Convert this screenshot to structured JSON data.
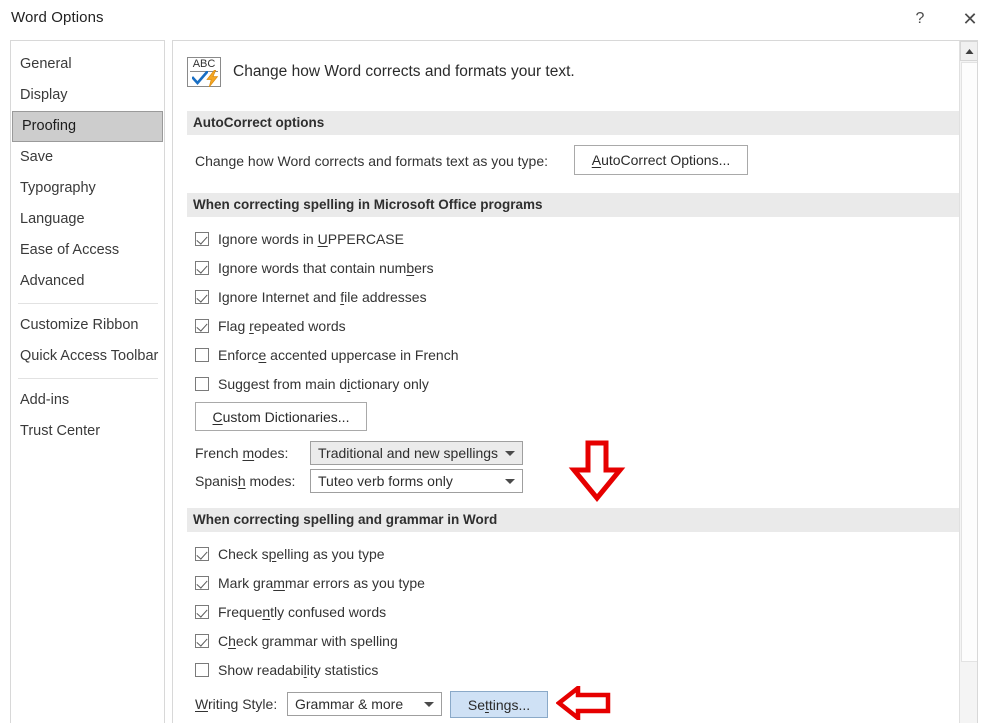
{
  "window": {
    "title": "Word Options",
    "help_label": "?",
    "close_label": "✕"
  },
  "sidebar": {
    "items": [
      {
        "label": "General",
        "selected": false
      },
      {
        "label": "Display",
        "selected": false
      },
      {
        "label": "Proofing",
        "selected": true
      },
      {
        "label": "Save",
        "selected": false
      },
      {
        "label": "Typography",
        "selected": false
      },
      {
        "label": "Language",
        "selected": false
      },
      {
        "label": "Ease of Access",
        "selected": false
      },
      {
        "label": "Advanced",
        "selected": false
      },
      {
        "label": "Customize Ribbon",
        "selected": false
      },
      {
        "label": "Quick Access Toolbar",
        "selected": false
      },
      {
        "label": "Add-ins",
        "selected": false
      },
      {
        "label": "Trust Center",
        "selected": false
      }
    ]
  },
  "header": {
    "icon_name": "abc-spellcheck-icon",
    "icon_text": "ABC",
    "description": "Change how Word corrects and formats your text."
  },
  "sections": {
    "autocorrect": {
      "heading": "AutoCorrect options",
      "row_label": "Change how Word corrects and formats text as you type:",
      "button_label": "AutoCorrect Options...",
      "button_accel": "A"
    },
    "office_spelling": {
      "heading": "When correcting spelling in Microsoft Office programs",
      "checkboxes": [
        {
          "label_before": "Ignore words in ",
          "accel": "U",
          "label_after": "PPERCASE",
          "checked": true
        },
        {
          "label_before": "Ignore words that contain num",
          "accel": "b",
          "label_after": "ers",
          "checked": true
        },
        {
          "label_before": "Ignore Internet and ",
          "accel": "f",
          "label_after": "ile addresses",
          "checked": true
        },
        {
          "label_before": "Flag ",
          "accel": "r",
          "label_after": "epeated words",
          "checked": true
        },
        {
          "label_before": "Enforc",
          "accel": "e",
          "label_after": " accented uppercase in French",
          "checked": false
        },
        {
          "label_before": "Suggest from main d",
          "accel": "i",
          "label_after": "ctionary only",
          "checked": false
        }
      ],
      "custom_dictionaries_button": "Custom Dictionaries...",
      "custom_dictionaries_accel": "C",
      "french_label_before": "French ",
      "french_label_accel": "m",
      "french_label_after": "odes:",
      "french_value": "Traditional and new spellings",
      "spanish_label_before": "Spanis",
      "spanish_label_accel": "h",
      "spanish_label_after": " modes:",
      "spanish_value": "Tuteo verb forms only"
    },
    "word_grammar": {
      "heading": "When correcting spelling and grammar in Word",
      "checkboxes": [
        {
          "label_before": "Check s",
          "accel": "p",
          "label_after": "elling as you type",
          "checked": true
        },
        {
          "label_before": "Mark gra",
          "accel": "m",
          "label_after": "mar errors as you type",
          "checked": true
        },
        {
          "label_before": "Freque",
          "accel": "n",
          "label_after": "tly confused words",
          "checked": true
        },
        {
          "label_before": "C",
          "accel": "h",
          "label_after": "eck grammar with spelling",
          "checked": true
        },
        {
          "label_before": "Show readabi",
          "accel": "l",
          "label_after": "ity statistics",
          "checked": false
        }
      ],
      "writing_style_label_before": "",
      "writing_style_accel": "W",
      "writing_style_label_after": "riting Style:",
      "writing_style_value": "Grammar & more",
      "settings_button": "Settings...",
      "settings_accel": "t"
    }
  },
  "annotations": {
    "arrow_down_name": "red-down-arrow-annotation",
    "arrow_left_name": "red-left-arrow-annotation",
    "color": "#e60000"
  },
  "scrollbar": {
    "up_arrow": "▲"
  }
}
